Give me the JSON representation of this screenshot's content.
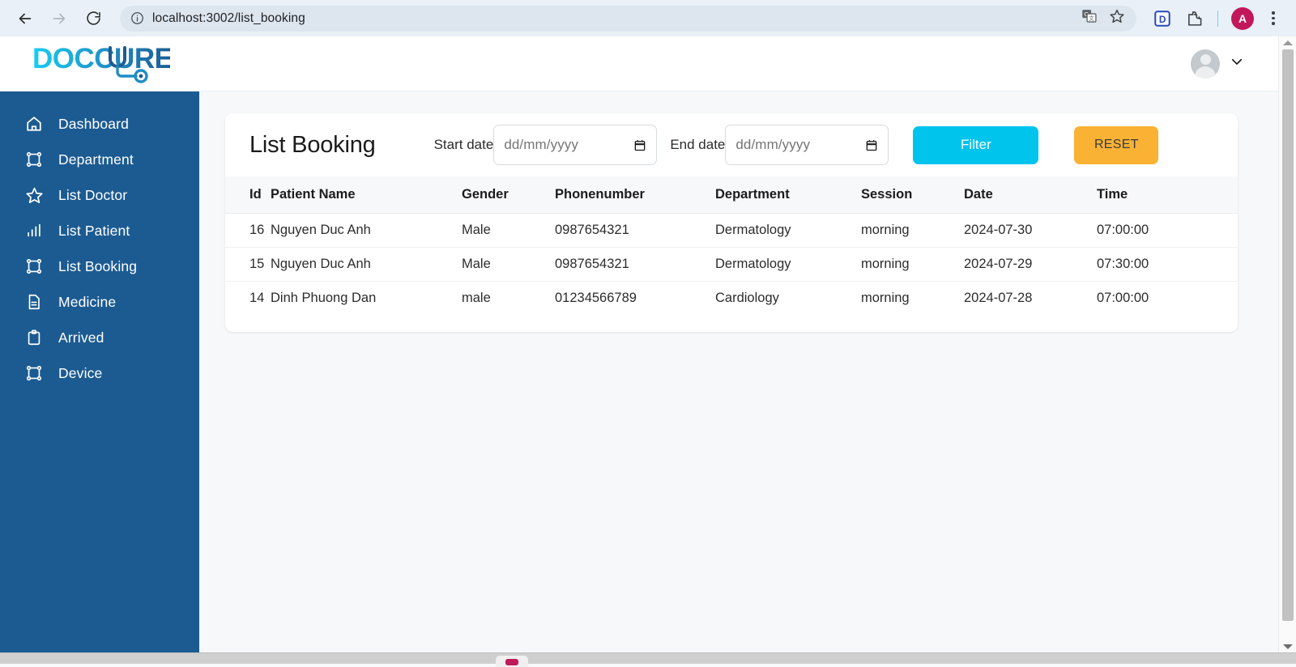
{
  "browser": {
    "url": "localhost:3002/list_booking",
    "back_label": "back-arrow",
    "forward_label": "forward-arrow",
    "reload_label": "reload",
    "site_info_label": "site-information",
    "translate_label": "translate",
    "bookmark_label": "bookmark-star",
    "extension_d_label": "D",
    "extensions_label": "extensions",
    "profile_initial": "A",
    "menu_label": "chrome-menu"
  },
  "header": {
    "logo_text": "DOCCURE",
    "logo_colors": {
      "start": "#18cdf0",
      "end": "#1d5b92"
    },
    "account_chevron": "chevron-down"
  },
  "sidebar": {
    "background": "#1c5b92",
    "items": [
      {
        "label": "Dashboard",
        "icon": "home-icon"
      },
      {
        "label": "Department",
        "icon": "frame-icon"
      },
      {
        "label": "List Doctor",
        "icon": "star-icon"
      },
      {
        "label": "List Patient",
        "icon": "bar-chart-icon"
      },
      {
        "label": "List Booking",
        "icon": "frame-icon"
      },
      {
        "label": "Medicine",
        "icon": "document-icon"
      },
      {
        "label": "Arrived",
        "icon": "clipboard-icon"
      },
      {
        "label": "Device",
        "icon": "frame-icon"
      }
    ]
  },
  "main": {
    "title": "List Booking",
    "filters": {
      "start_date": {
        "label": "Start date",
        "value": "",
        "placeholder": "dd/mm/yyyy"
      },
      "end_date": {
        "label": "End date",
        "value": "",
        "placeholder": "dd/mm/yyyy"
      },
      "filter_button": {
        "label": "Filter",
        "color": "#00c4ec"
      },
      "reset_button": {
        "label": "RESET",
        "color": "#f9b233"
      }
    },
    "table": {
      "columns": [
        "Id",
        "Patient Name",
        "Gender",
        "Phonenumber",
        "Department",
        "Session",
        "Date",
        "Time"
      ],
      "rows": [
        {
          "id": "16",
          "patient_name": "Nguyen Duc Anh",
          "gender": "Male",
          "phonenumber": "0987654321",
          "department": "Dermatology",
          "session": "morning",
          "date": "2024-07-30",
          "time": "07:00:00"
        },
        {
          "id": "15",
          "patient_name": "Nguyen Duc Anh",
          "gender": "Male",
          "phonenumber": "0987654321",
          "department": "Dermatology",
          "session": "morning",
          "date": "2024-07-29",
          "time": "07:30:00"
        },
        {
          "id": "14",
          "patient_name": "Dinh Phuong Dan",
          "gender": "male",
          "phonenumber": "01234566789",
          "department": "Cardiology",
          "session": "morning",
          "date": "2024-07-28",
          "time": "07:00:00"
        }
      ]
    }
  }
}
